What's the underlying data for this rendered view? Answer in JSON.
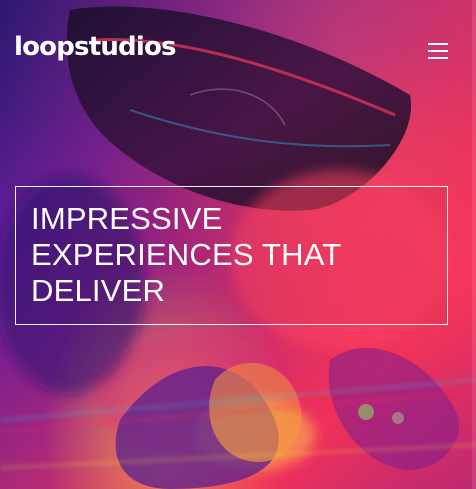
{
  "header": {
    "logo_text": "loopstudios",
    "menu_icon": "hamburger-menu-icon"
  },
  "hero": {
    "headline_lines": [
      "IMPRESSIVE",
      "EXPERIENCES THAT",
      "DELIVER"
    ],
    "background": {
      "description_colors": [
        "#2a1870",
        "#b32a76",
        "#ee2e5b",
        "#ffe646"
      ]
    }
  },
  "colors": {
    "text": "#ffffff",
    "accent_red": "#ee2e5b",
    "accent_purple": "#5a1f8f"
  }
}
